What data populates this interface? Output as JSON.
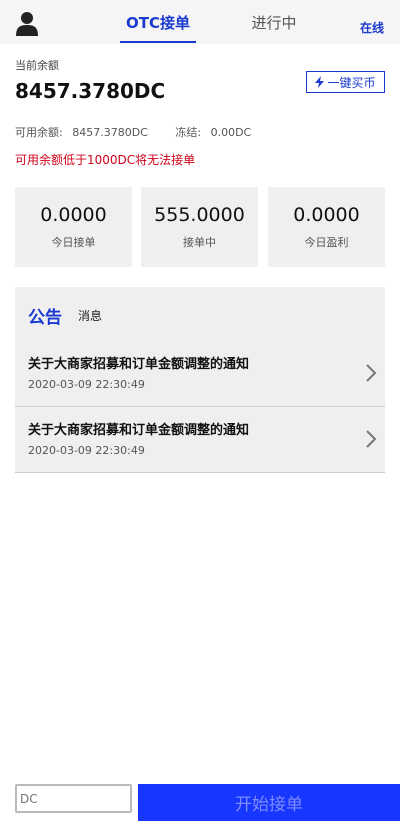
{
  "header": {
    "tabs": [
      {
        "label": "OTC接单",
        "active": true
      },
      {
        "label": "进行中",
        "active": false
      }
    ],
    "status": "在线"
  },
  "balance": {
    "label": "当前余额",
    "value": "8457.3780DC",
    "quick_buy_label": "一键买币",
    "available_label": "可用余额:",
    "available_value": "8457.3780DC",
    "frozen_label": "冻结:",
    "frozen_value": "0.00DC",
    "warning": "可用余额低于1000DC将无法接单"
  },
  "stats": [
    {
      "value": "0.0000",
      "label": "今日接单"
    },
    {
      "value": "555.0000",
      "label": "接单中"
    },
    {
      "value": "0.0000",
      "label": "今日盈利"
    }
  ],
  "notice": {
    "title": "公告",
    "tab_label": "消息",
    "items": [
      {
        "title": "关于大商家招募和订单金额调整的通知",
        "date": "2020-03-09 22:30:49"
      },
      {
        "title": "关于大商家招募和订单金额调整的通知",
        "date": "2020-03-09 22:30:49"
      }
    ]
  },
  "bottom": {
    "input_placeholder": "DC",
    "start_label": "开始接单"
  },
  "colors": {
    "accent": "#1a3ad0",
    "warning": "#d0021b",
    "button": "#1736ff"
  }
}
